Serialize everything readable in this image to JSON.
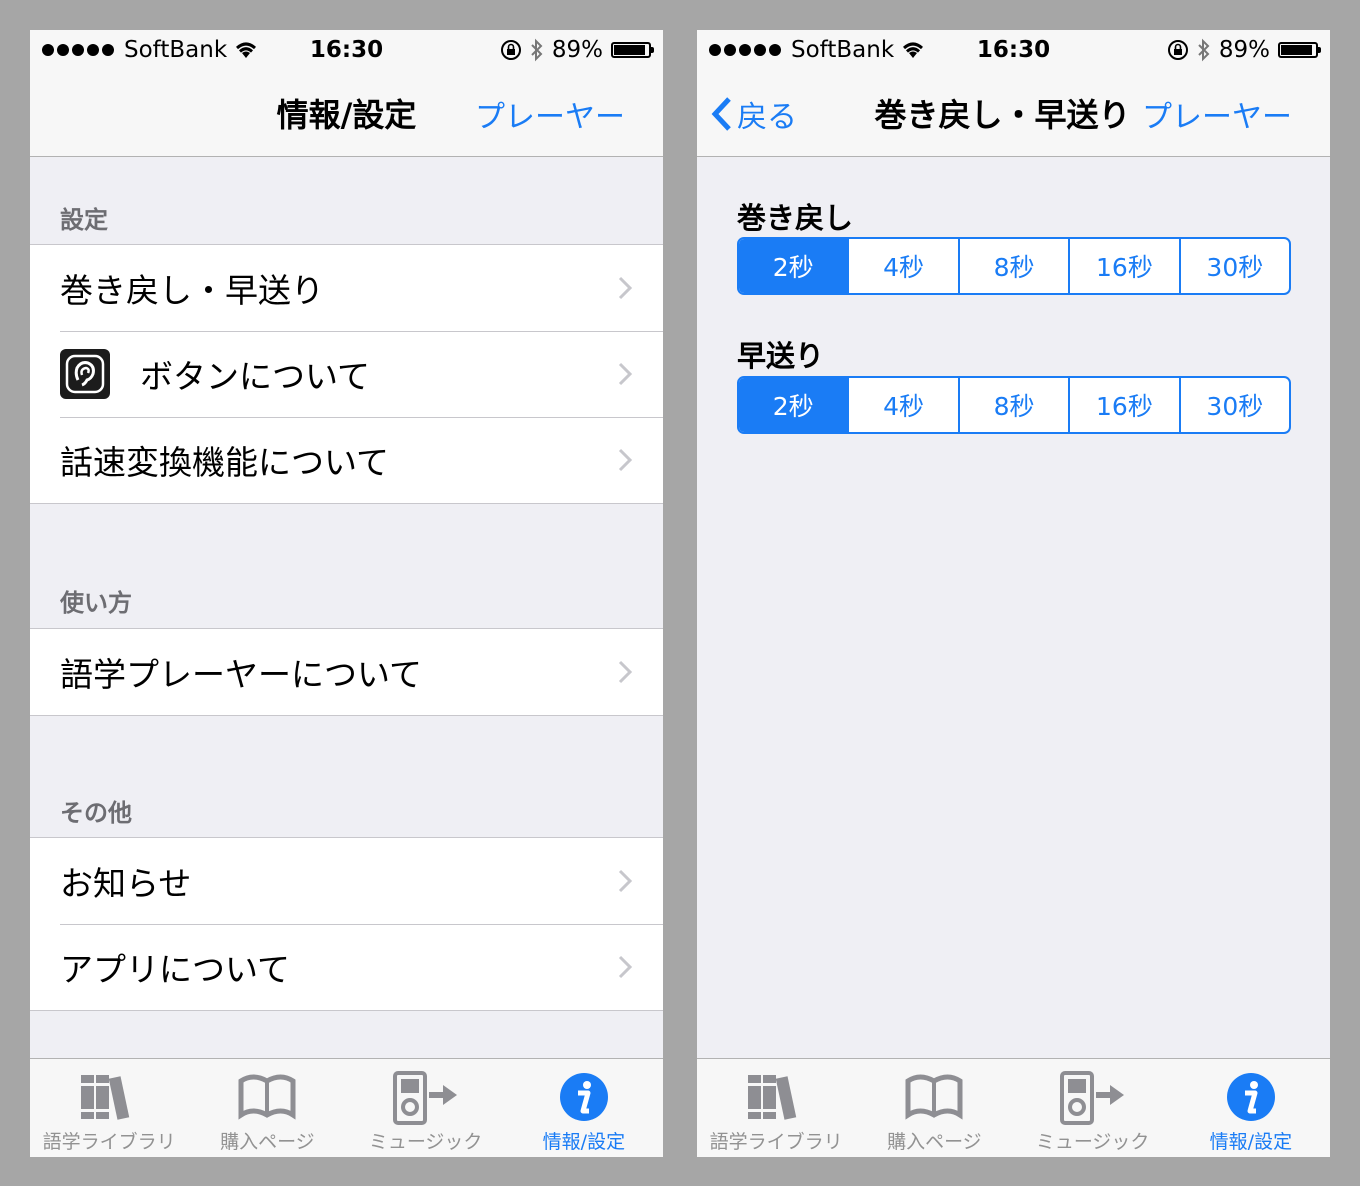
{
  "left_screen": {
    "status_bar": {
      "carrier": "SoftBank",
      "time": "16:30",
      "battery": "89%",
      "battery_level": 0.89
    },
    "nav": {
      "title": "情報/設定",
      "right_button": "プレーヤー"
    },
    "sections": [
      {
        "header": "設定",
        "items": [
          "巻き戻し・早送り",
          "ボタンについて",
          "話速変換機能について"
        ]
      },
      {
        "header": "使い方",
        "items": [
          "語学プレーヤーについて"
        ]
      },
      {
        "header": "その他",
        "items": [
          "お知らせ",
          "アプリについて"
        ]
      }
    ],
    "tabs": [
      "語学ライブラリ",
      "購入ページ",
      "ミュージック",
      "情報/設定"
    ]
  },
  "right_screen": {
    "status_bar": {
      "carrier": "SoftBank",
      "time": "16:30",
      "battery": "89%",
      "battery_level": 0.89
    },
    "nav": {
      "back": "戻る",
      "title": "巻き戻し・早送り",
      "right_button": "プレーヤー"
    },
    "rewind": {
      "label": "巻き戻し",
      "options": [
        "2秒",
        "4秒",
        "8秒",
        "16秒",
        "30秒"
      ],
      "selected": "2秒"
    },
    "forward": {
      "label": "早送り",
      "options": [
        "2秒",
        "4秒",
        "8秒",
        "16秒",
        "30秒"
      ],
      "selected": "2秒"
    },
    "tabs": [
      "語学ライブラリ",
      "購入ページ",
      "ミュージック",
      "情報/設定"
    ]
  },
  "colors": {
    "accent": "#1a7cf5",
    "background": "#efeff4",
    "frame": "#a6a6a6"
  },
  "icons": [
    "wifi-icon",
    "rotation-lock-icon",
    "bluetooth-icon",
    "battery-icon",
    "chevron-right-icon",
    "ear-icon",
    "back-chevron-icon",
    "library-icon",
    "book-icon",
    "music-export-icon",
    "info-icon"
  ]
}
